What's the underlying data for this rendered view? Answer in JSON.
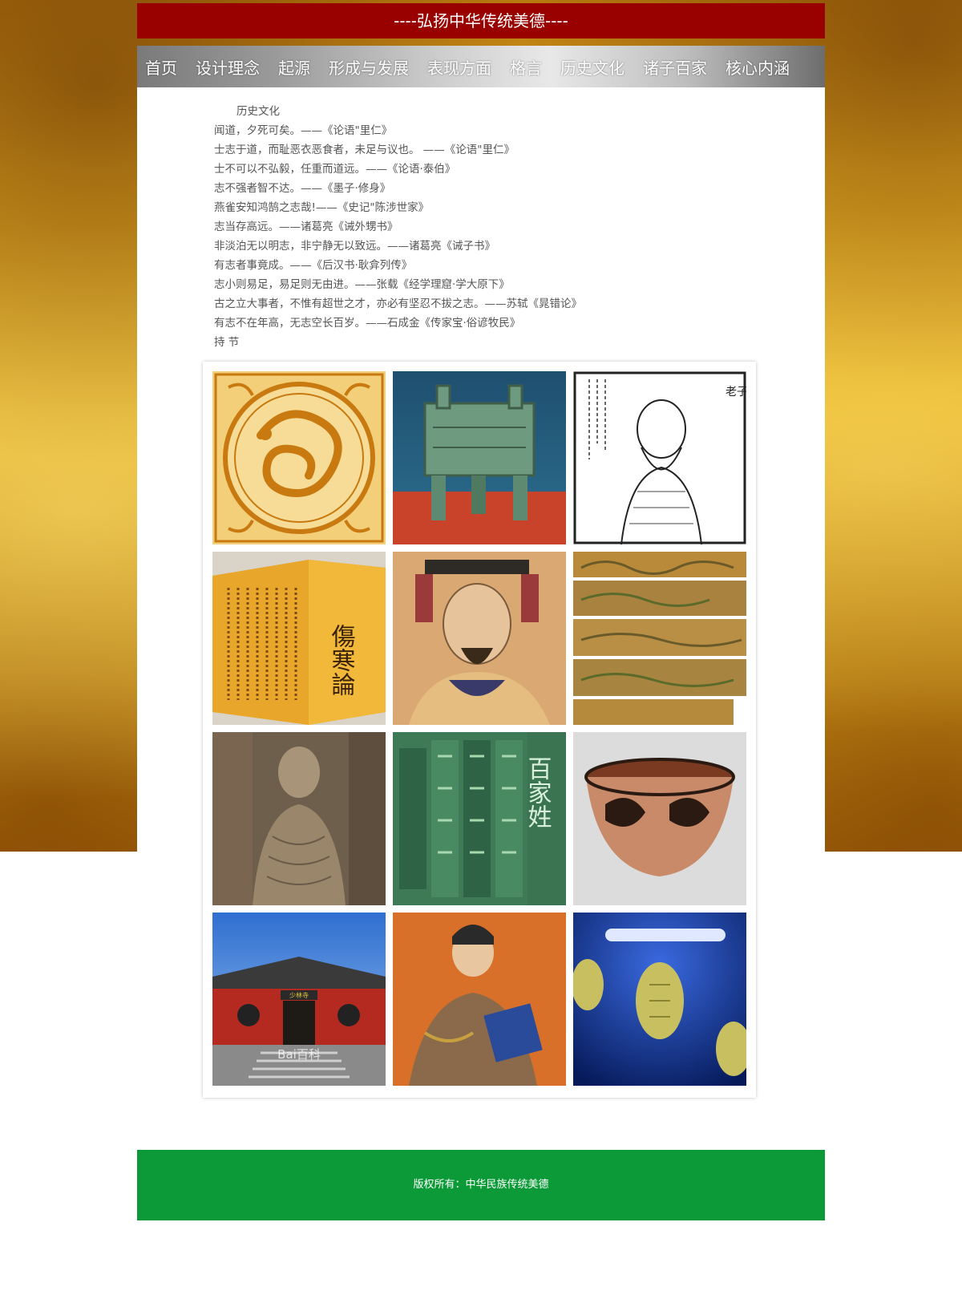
{
  "header": {
    "title": "----弘扬中华传统美德----"
  },
  "nav": {
    "items": [
      {
        "label": "首页"
      },
      {
        "label": "设计理念"
      },
      {
        "label": "起源"
      },
      {
        "label": "形成与发展"
      },
      {
        "label": "表现方面"
      },
      {
        "label": "格言"
      },
      {
        "label": "历史文化"
      },
      {
        "label": "诸子百家"
      },
      {
        "label": "核心内涵"
      }
    ]
  },
  "main": {
    "heading": "历史文化",
    "lines": [
      "闻道，夕死可矣。——《论语\"里仁》",
      "士志于道，而耻恶衣恶食者，未足与议也。 ——《论语\"里仁》",
      "士不可以不弘毅，任重而道远。——《论语·泰伯》",
      "志不强者智不达。——《墨子·修身》",
      "燕雀安知鸿鹄之志哉!——《史记\"陈涉世家》",
      "志当存高远。——诸葛亮《诫外甥书》",
      "非淡泊无以明志，非宁静无以致远。——诸葛亮《诫子书》",
      "有志者事竟成。——《后汉书·耿弇列传》",
      "志小则易足，易足则无由进。——张载《经学理窟·学大原下》",
      "古之立大事者，不惟有超世之才，亦必有坚忍不拔之志。——苏轼《晁错论》",
      "有志不在年高，无志空长百岁。——石成金《传家宝·俗谚牧民》",
      "持 节"
    ]
  },
  "gallery": {
    "images": [
      {
        "name": "dragon-emblem-image",
        "caption_art": "",
        "colors": [
          "#f3cf7a",
          "#c87a10"
        ]
      },
      {
        "name": "bronze-ding-image",
        "caption_art": "",
        "colors": [
          "#2a6a8a",
          "#6e9a80"
        ]
      },
      {
        "name": "laozi-portrait-image",
        "caption_art": "老子",
        "colors": [
          "#ffffff",
          "#222222"
        ]
      },
      {
        "name": "shanghan-lun-book-image",
        "caption_art": "傷寒論",
        "colors": [
          "#e8a72a",
          "#7a4a10"
        ]
      },
      {
        "name": "emperor-portrait-image",
        "caption_art": "",
        "colors": [
          "#d9a873",
          "#3a3a6a"
        ]
      },
      {
        "name": "qingming-scroll-image",
        "caption_art": "",
        "colors": [
          "#b98a3a",
          "#6a5a2a"
        ]
      },
      {
        "name": "buddha-statue-image",
        "caption_art": "",
        "colors": [
          "#8c7a62",
          "#5a4a38"
        ]
      },
      {
        "name": "baijiaxing-image",
        "caption_art": "百家姓",
        "colors": [
          "#3e7a55",
          "#a8d8b0"
        ]
      },
      {
        "name": "painted-pottery-bowl-image",
        "caption_art": "",
        "colors": [
          "#c98a6a",
          "#2a1a12"
        ]
      },
      {
        "name": "shaolin-temple-image",
        "caption_art": "少林寺",
        "colors": [
          "#3a7ad9",
          "#b52a20"
        ]
      },
      {
        "name": "scholar-reading-image",
        "caption_art": "",
        "colors": [
          "#d9702a",
          "#2a4a9a"
        ]
      },
      {
        "name": "oracle-bones-image",
        "caption_art": "",
        "colors": [
          "#0a2a8a",
          "#c8c060"
        ]
      }
    ],
    "watermark": "Bai百科"
  },
  "footer": {
    "text": "版权所有：中华民族传统美德"
  }
}
